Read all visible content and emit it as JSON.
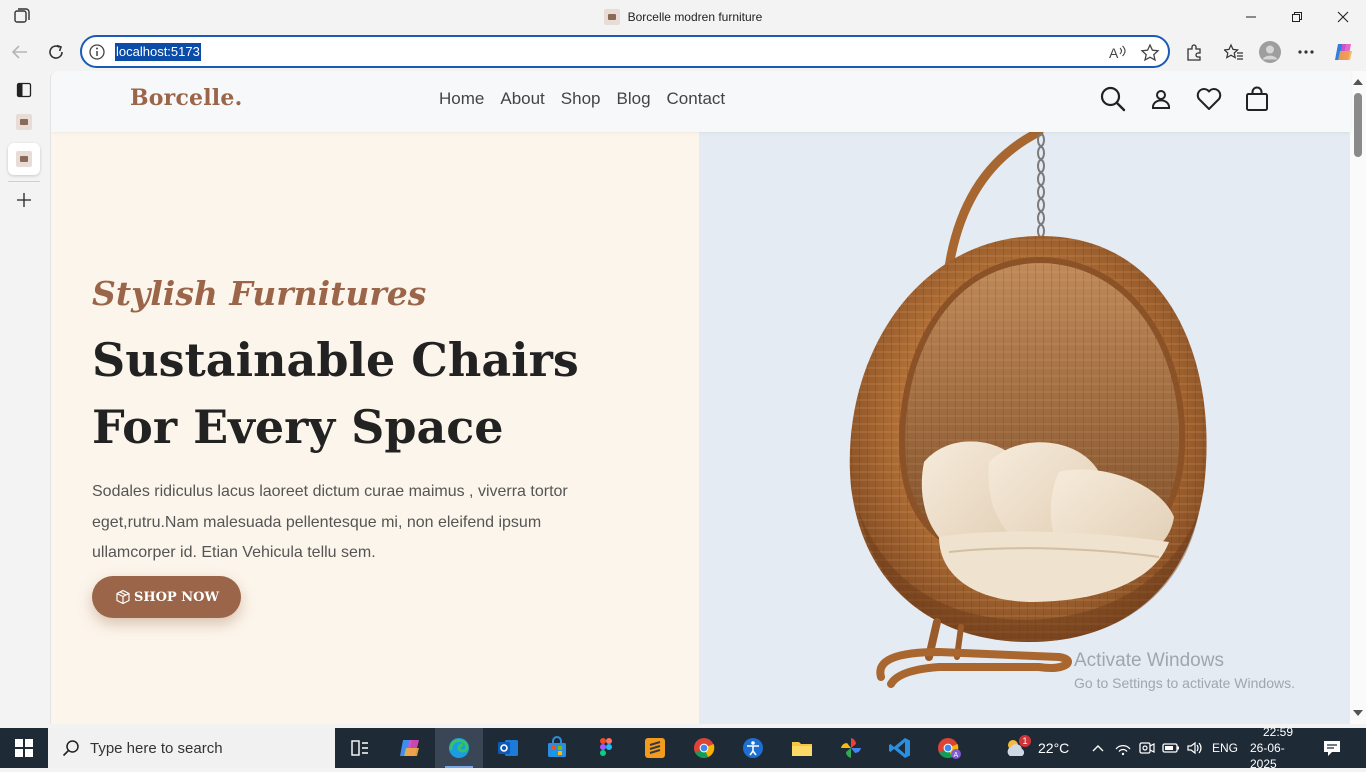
{
  "browser": {
    "tab_title": "Borcelle modren furniture",
    "url": "localhost:5173"
  },
  "site": {
    "logo": "Borcelle.",
    "nav": [
      "Home",
      "About",
      "Shop",
      "Blog",
      "Contact"
    ]
  },
  "hero": {
    "eyebrow": "Stylish Furnitures",
    "headline_line1": "Sustainable Chairs",
    "headline_line2": "For Every Space",
    "description": "Sodales ridiculus lacus laoreet dictum curae maimus , viverra tortor eget,rutru.Nam malesuada pellentesque mi, non eleifend ipsum ullamcorper id. Etian Vehicula tellu sem.",
    "cta": "SHOP NOW",
    "image": "hanging-rattan-egg-chair"
  },
  "watermark": {
    "title": "Activate Windows",
    "subtitle": "Go to Settings to activate Windows."
  },
  "taskbar": {
    "search_placeholder": "Type here to search",
    "weather_temp": "22°C",
    "weather_badge": "1",
    "language": "ENG",
    "time": "22:59",
    "date": "26-06-2025"
  },
  "colors": {
    "brand": "#9a6548",
    "hero_left_bg": "#fcf5eb",
    "hero_right_bg": "#e5ebf3",
    "url_outline": "#1a5bb5"
  }
}
